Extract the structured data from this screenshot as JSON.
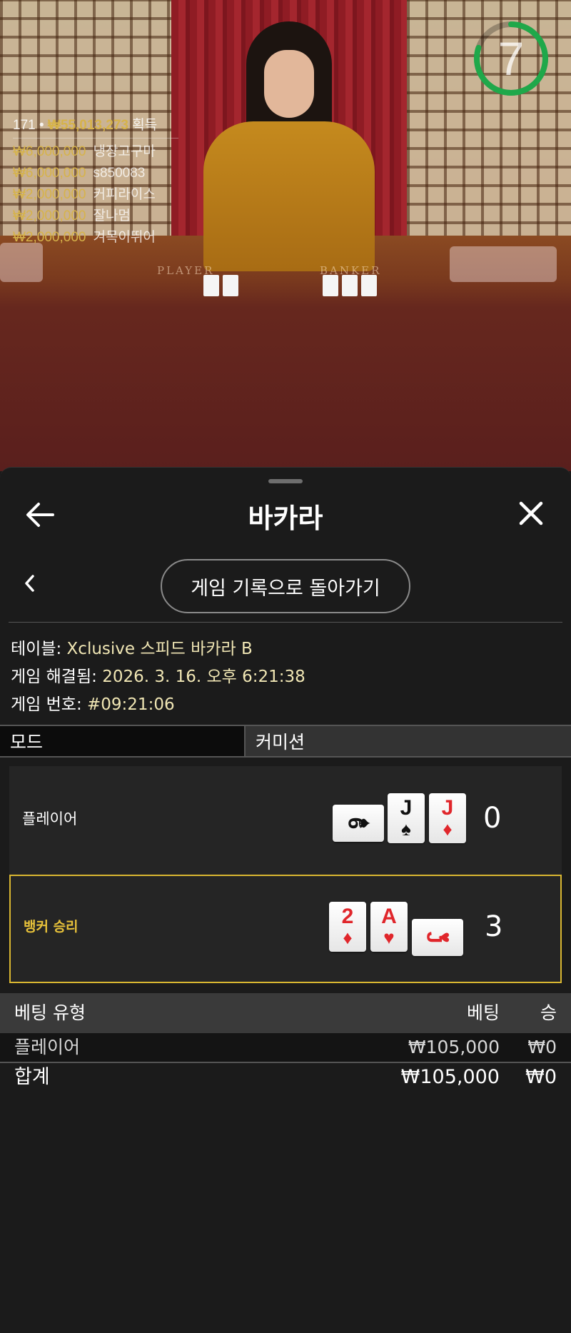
{
  "stream": {
    "countdown": "7",
    "countdown_progress": 0.8,
    "winners_count": "171",
    "winners_total_amount": "₩55,013,273",
    "winners_total_suffix": "획득",
    "winners": [
      {
        "amount": "₩6,000,000",
        "name": "냉장고구마"
      },
      {
        "amount": "₩6,000,000",
        "name": "s850083"
      },
      {
        "amount": "₩2,000,000",
        "name": "커피라이스"
      },
      {
        "amount": "₩2,000,000",
        "name": "잘나멈"
      },
      {
        "amount": "₩2,000,000",
        "name": "겨목이뛰어"
      }
    ],
    "table_label_player": "PLAYER",
    "table_label_banker": "BANKER"
  },
  "header": {
    "title": "바카라",
    "back_icon": "arrow-left-icon",
    "close_icon": "close-icon"
  },
  "history_nav": {
    "prev_icon": "chevron-left-icon",
    "back_button_label": "게임 기록으로 돌아가기"
  },
  "info": {
    "table_label": "테이블:",
    "table_value": "Xclusive 스피드 바카라 B",
    "resolved_label": "게임 해결됨:",
    "resolved_value": "2026. 3. 16. 오후 6:21:38",
    "game_no_label": "게임 번호:",
    "game_no_value": "#09:21:06"
  },
  "tabs": {
    "mode": "모드",
    "commission": "커미션"
  },
  "hands": {
    "player": {
      "label": "플레이어",
      "score": "0",
      "cards": [
        {
          "rank": "6",
          "suit": "♠",
          "color": "#111111",
          "orientation": "horizontal"
        },
        {
          "rank": "J",
          "suit": "♠",
          "color": "#111111",
          "orientation": "vertical"
        },
        {
          "rank": "J",
          "suit": "♦",
          "color": "#e0262b",
          "orientation": "vertical"
        }
      ]
    },
    "banker": {
      "label": "뱅커 승리",
      "score": "3",
      "highlight_color": "#d9b731",
      "cards": [
        {
          "rank": "2",
          "suit": "♦",
          "color": "#e0262b",
          "orientation": "vertical"
        },
        {
          "rank": "A",
          "suit": "♥",
          "color": "#e0262b",
          "orientation": "vertical"
        },
        {
          "rank": "J",
          "suit": "♥",
          "color": "#e0262b",
          "orientation": "horizontal"
        }
      ]
    }
  },
  "bets": {
    "headers": {
      "type": "베팅 유형",
      "bet": "베팅",
      "win": "승"
    },
    "rows": [
      {
        "type": "플레이어",
        "bet": "₩105,000",
        "win": "₩0"
      }
    ],
    "total": {
      "label": "합계",
      "bet": "₩105,000",
      "win": "₩0"
    }
  }
}
